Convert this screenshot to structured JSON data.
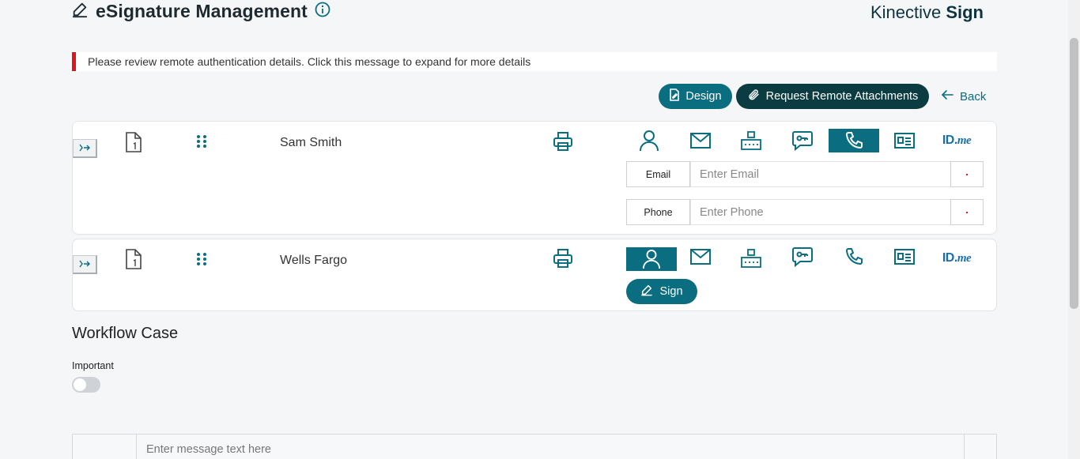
{
  "header": {
    "title": "eSignature Management",
    "brand_light": "Kinective ",
    "brand_bold": "Sign"
  },
  "alert": {
    "message": "Please review remote authentication details. Click this message to expand for more details"
  },
  "actions": {
    "design_label": "Design",
    "remote_label": "Request Remote Attachments",
    "back_label": "Back"
  },
  "signers": [
    {
      "name": "Sam Smith",
      "active_auth": "phone",
      "fields": [
        {
          "label": "Email",
          "placeholder": "Enter Email"
        },
        {
          "label": "Phone",
          "placeholder": "Enter Phone"
        }
      ]
    },
    {
      "name": "Wells Fargo",
      "active_auth": "in-person",
      "sign_label": "Sign"
    }
  ],
  "auth_methods": [
    "in-person-icon",
    "email-icon",
    "kba-icon",
    "sms-otp-icon",
    "phone-icon",
    "id-card-icon",
    "id-me-logo"
  ],
  "idme": {
    "id": "ID.",
    "me": "me"
  },
  "workflow": {
    "title": "Workflow Case",
    "important_label": "Important",
    "important_on": false,
    "message_placeholder": "Enter message text here"
  },
  "colors": {
    "teal": "#0b6d80",
    "dark_teal": "#0b3c42",
    "alert_red": "#e3131a"
  }
}
